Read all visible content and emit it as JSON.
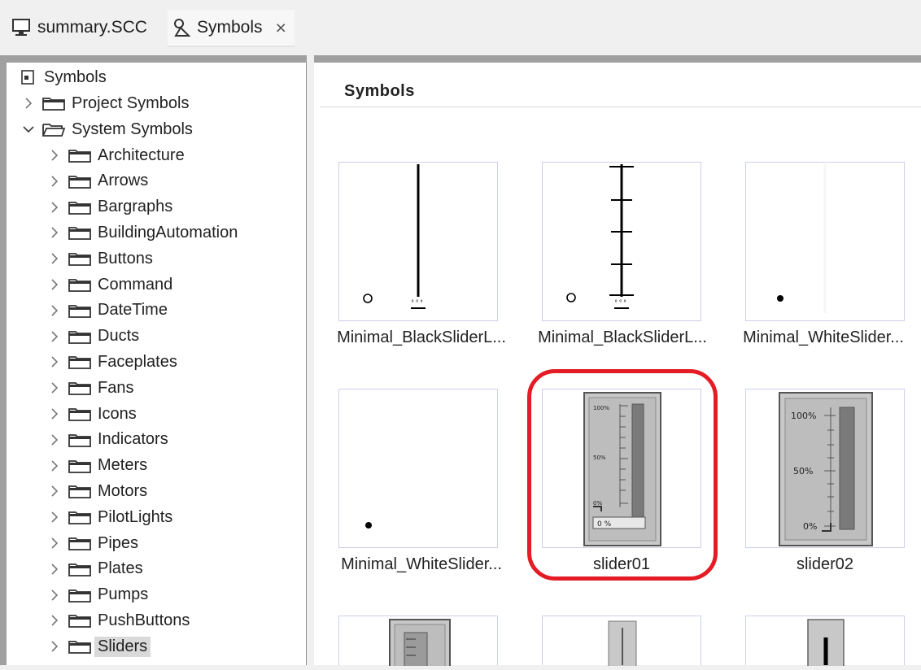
{
  "tabs": [
    {
      "label": "summary.SCC",
      "icon": "monitor-icon"
    },
    {
      "label": "Symbols",
      "icon": "symbols-icon",
      "close": "×"
    }
  ],
  "tree": {
    "root": "Symbols",
    "project": "Project Symbols",
    "system": "System Symbols",
    "children": [
      "Architecture",
      "Arrows",
      "Bargraphs",
      "BuildingAutomation",
      "Buttons",
      "Command",
      "DateTime",
      "Ducts",
      "Faceplates",
      "Fans",
      "Icons",
      "Indicators",
      "Meters",
      "Motors",
      "PilotLights",
      "Pipes",
      "Plates",
      "Pumps",
      "PushButtons",
      "Sliders"
    ],
    "selected": "Sliders"
  },
  "gallery": {
    "title": "Symbols",
    "items": [
      {
        "caption": "Minimal_BlackSliderL..."
      },
      {
        "caption": "Minimal_BlackSliderL..."
      },
      {
        "caption": "Minimal_WhiteSlider..."
      },
      {
        "caption": "Minimal_WhiteSlider..."
      },
      {
        "caption": "slider01"
      },
      {
        "caption": "slider02"
      }
    ],
    "slider01": {
      "top": "100%",
      "mid": "50%",
      "bottom": "0%",
      "readout": "0 %"
    },
    "slider02": {
      "top": "100%",
      "mid": "50%",
      "bottom": "0%"
    },
    "highlight_color": "#e31c25"
  }
}
